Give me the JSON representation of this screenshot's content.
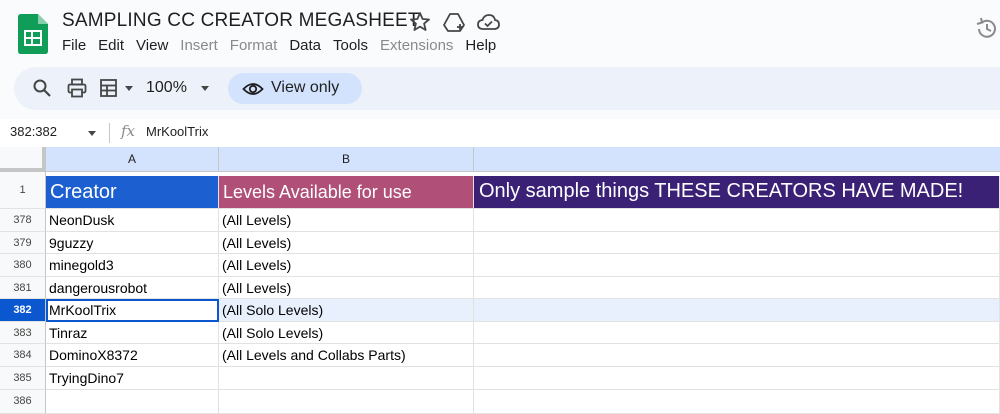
{
  "app": {
    "doc_title": "SAMPLING CC CREATOR MEGASHEET",
    "menu": [
      {
        "label": "File",
        "enabled": true
      },
      {
        "label": "Edit",
        "enabled": true
      },
      {
        "label": "View",
        "enabled": true
      },
      {
        "label": "Insert",
        "enabled": false
      },
      {
        "label": "Format",
        "enabled": false
      },
      {
        "label": "Data",
        "enabled": true
      },
      {
        "label": "Tools",
        "enabled": true
      },
      {
        "label": "Extensions",
        "enabled": false
      },
      {
        "label": "Help",
        "enabled": true
      }
    ],
    "title_icons": [
      "star-icon",
      "move-to-drive-icon",
      "cloud-status-icon"
    ],
    "history_icon": "version-history-icon"
  },
  "toolbar": {
    "zoom": "100%",
    "view_only_label": "View only",
    "icons": [
      "search-icon",
      "print-icon",
      "paint-format-icon",
      "eye-icon"
    ]
  },
  "formula_bar": {
    "name_box": "382:382",
    "fx_label": "fx",
    "value": "MrKoolTrix"
  },
  "sheet": {
    "columns": [
      "A",
      "B",
      ""
    ],
    "header_row": {
      "row_number": "1",
      "creator": "Creator",
      "levels": "Levels Available for use",
      "note": "Only sample things THESE CREATORS HAVE MADE!"
    },
    "rows": [
      {
        "num": "378",
        "creator": "NeonDusk",
        "levels": "(All Levels)"
      },
      {
        "num": "379",
        "creator": "9guzzy",
        "levels": "(All Levels)"
      },
      {
        "num": "380",
        "creator": "minegold3",
        "levels": "(All Levels)"
      },
      {
        "num": "381",
        "creator": "dangerousrobot",
        "levels": "(All Levels)"
      },
      {
        "num": "382",
        "creator": "MrKoolTrix",
        "levels": "(All Solo Levels)"
      },
      {
        "num": "383",
        "creator": "Tinraz",
        "levels": "(All Solo Levels)"
      },
      {
        "num": "384",
        "creator": "DominoX8372",
        "levels": "(All Levels and Collabs Parts)"
      },
      {
        "num": "385",
        "creator": "TryingDino7",
        "levels": ""
      },
      {
        "num": "386",
        "creator": "",
        "levels": ""
      }
    ],
    "selected_row": "382"
  },
  "colors": {
    "creator_header": "#1c5fd0",
    "levels_header": "#b04f78",
    "note_header": "#3a2176",
    "selection": "#0b57d0",
    "view_only_chip": "#d3e3fd"
  }
}
